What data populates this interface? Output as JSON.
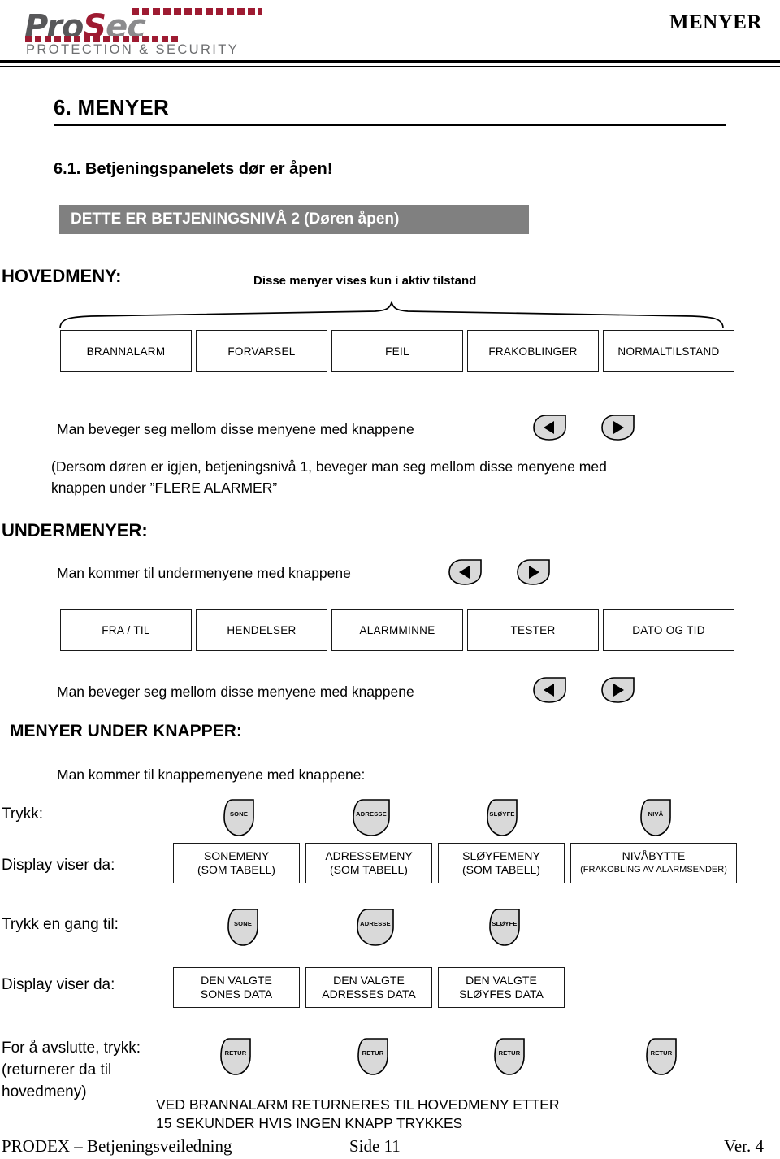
{
  "header": {
    "logo_pro": "Pro",
    "logo_s": "S",
    "logo_ec": "ec",
    "tagline": "PROTECTION & SECURITY",
    "title": "MENYER",
    "brand_red": "#9e1b32",
    "brand_gray": "#58585a"
  },
  "section": {
    "h1": "6.  MENYER",
    "h2": "6.1. Betjeningspanelets dør er åpen!"
  },
  "banner": {
    "text": "DETTE ER BETJENINGSNIVÅ 2 (Døren åpen)",
    "bg": "#808080",
    "fg": "#ffffff"
  },
  "labels": {
    "hovedmeny": "HOVEDMENY:",
    "aktiv_note": "Disse menyer vises kun i aktiv tilstand",
    "undermenyer": "UNDERMENYER:",
    "menyer_under_knapper": "MENYER UNDER KNAPPER:"
  },
  "body_text": {
    "move_main": "Man beveger seg mellom disse menyene med knappene",
    "parenthetical": "(Dersom døren er igjen, betjeningsnivå 1, beveger man seg mellom disse menyene med\nknappen under ”FLERE ALARMER”",
    "sub_access": "Man kommer til undermenyene med knappene",
    "move_sub": "Man beveger seg mellom disse menyene med knappene",
    "button_access": "Man kommer til knappemenyene med knappene:"
  },
  "main_menu": {
    "items": [
      {
        "label": "BRANNALARM"
      },
      {
        "label": "FORVARSEL"
      },
      {
        "label": "FEIL"
      },
      {
        "label": "FRAKOBLINGER"
      },
      {
        "label": "NORMALTILSTAND"
      }
    ]
  },
  "sub_menu": {
    "items": [
      {
        "label": "FRA / TIL"
      },
      {
        "label": "HENDELSER"
      },
      {
        "label": "ALARMMINNE"
      },
      {
        "label": "TESTER"
      },
      {
        "label": "DATO OG TID"
      }
    ]
  },
  "row_labels": {
    "trykk": "Trykk:",
    "display_viser_da_1": "Display viser da:",
    "trykk_en_gang_til": "Trykk en gang til:",
    "display_viser_da_2": "Display viser da:",
    "avslutte": "For å avslutte, trykk:\n(returnerer da til\nhovedmeny)"
  },
  "press_row_1": {
    "buttons": [
      {
        "label": "SONE"
      },
      {
        "label": "ADRESSE"
      },
      {
        "label": "SLØYFE"
      },
      {
        "label": "NIVÅ"
      }
    ],
    "displays": [
      {
        "line1": "SONEMENY",
        "line2": "(SOM TABELL)"
      },
      {
        "line1": "ADRESSEMENY",
        "line2": "(SOM TABELL)"
      },
      {
        "line1": "SLØYFEMENY",
        "line2": "(SOM TABELL)"
      },
      {
        "line1": "NIVÅBYTTE",
        "line2": "(FRAKOBLING AV ALARMSENDER)"
      }
    ]
  },
  "press_row_2": {
    "buttons": [
      {
        "label": "SONE"
      },
      {
        "label": "ADRESSE"
      },
      {
        "label": "SLØYFE"
      }
    ],
    "displays": [
      {
        "line1": "DEN VALGTE",
        "line2": "SONES DATA"
      },
      {
        "line1": "DEN VALGTE",
        "line2": "ADRESSES DATA"
      },
      {
        "line1": "DEN VALGTE",
        "line2": "SLØYFES DATA"
      }
    ]
  },
  "press_row_3": {
    "buttons": [
      {
        "label": "RETUR"
      },
      {
        "label": "RETUR"
      },
      {
        "label": "RETUR"
      },
      {
        "label": "RETUR"
      }
    ]
  },
  "arrow_keys": {
    "left_icon": "arrow-left-icon",
    "right_icon": "arrow-right-icon"
  },
  "footer_note": "VED BRANNALARM RETURNERES TIL HOVEDMENY ETTER\n15 SEKUNDER HVIS INGEN KNAPP TRYKKES",
  "footer": {
    "left": "PRODEX – Betjeningsveiledning",
    "center": "Side 11",
    "right": "Ver. 4"
  }
}
